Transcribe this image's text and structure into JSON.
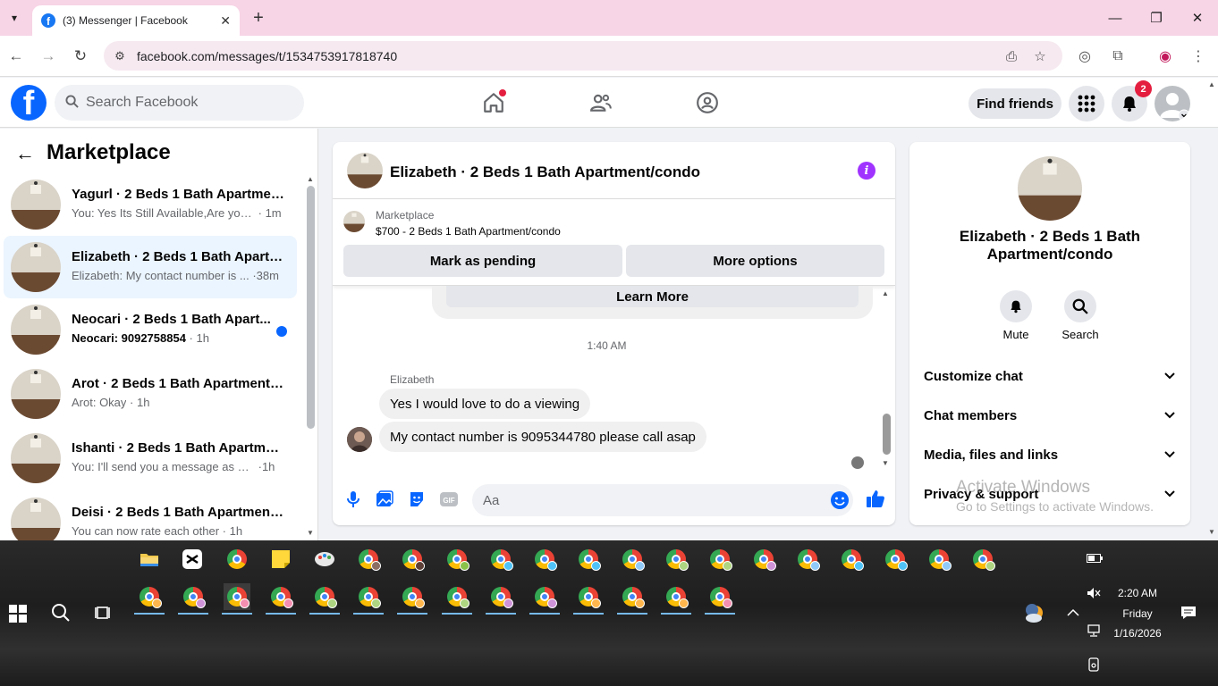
{
  "browser": {
    "tab_title": "(3) Messenger | Facebook",
    "url": "facebook.com/messages/t/1534753917818740"
  },
  "fb": {
    "search_placeholder": "Search Facebook",
    "find_friends": "Find friends",
    "notification_count": "2"
  },
  "marketplace": {
    "title": "Marketplace",
    "conversations": [
      {
        "title": "Yagurl · 2 Beds 1 Bath Apartmen...",
        "preview": "You: Yes Its Still Available,Are you i...",
        "time": "1m",
        "unread": false,
        "active": false
      },
      {
        "title": "Elizabeth · 2 Beds 1 Bath Apartm...",
        "preview": "Elizabeth: My contact number is ...",
        "time": "38m",
        "unread": false,
        "active": true
      },
      {
        "title": "Neocari · 2 Beds 1 Bath Apart...",
        "preview": "Neocari: 9092758854",
        "time": "1h",
        "unread": true,
        "active": false
      },
      {
        "title": "Arot · 2 Beds 1 Bath Apartment/...",
        "preview": "Arot: Okay",
        "time": "1h",
        "unread": false,
        "active": false
      },
      {
        "title": "Ishanti · 2 Beds 1 Bath Apartmen...",
        "preview": "You: I'll send you a message as soo...",
        "time": "1h",
        "unread": false,
        "active": false
      },
      {
        "title": "Deisi · 2 Beds 1 Bath Apartment/...",
        "preview": "You can now rate each other",
        "time": "1h",
        "unread": false,
        "active": false
      }
    ]
  },
  "chat": {
    "header_name": "Elizabeth · 2 Beds 1 Bath Apartment/condo",
    "listing_label": "Marketplace",
    "listing_price": "$700 - 2 Beds 1 Bath Apartment/condo",
    "mark_pending": "Mark as pending",
    "more_options": "More options",
    "learn_more": "Learn More",
    "timestamp": "1:40 AM",
    "sender": "Elizabeth",
    "messages": [
      "Yes I would love to do a viewing",
      "My contact number is 9095344780 please call asap"
    ],
    "composer_placeholder": "Aa"
  },
  "details": {
    "name": "Elizabeth · 2 Beds 1 Bath Apartment/condo",
    "mute": "Mute",
    "search": "Search",
    "sections": [
      "Customize chat",
      "Chat members",
      "Media, files and links",
      "Privacy & support"
    ]
  },
  "watermark": {
    "line1": "Activate Windows",
    "line2": "Go to Settings to activate Windows."
  },
  "tray": {
    "time": "2:20 AM",
    "day": "Friday",
    "date": "1/16/2026"
  },
  "colors": {
    "fb_blue": "#0866ff",
    "tabstrip_pink": "#f7d4e6",
    "info_purple": "#a033ff",
    "badge_red": "#e41e3f"
  }
}
